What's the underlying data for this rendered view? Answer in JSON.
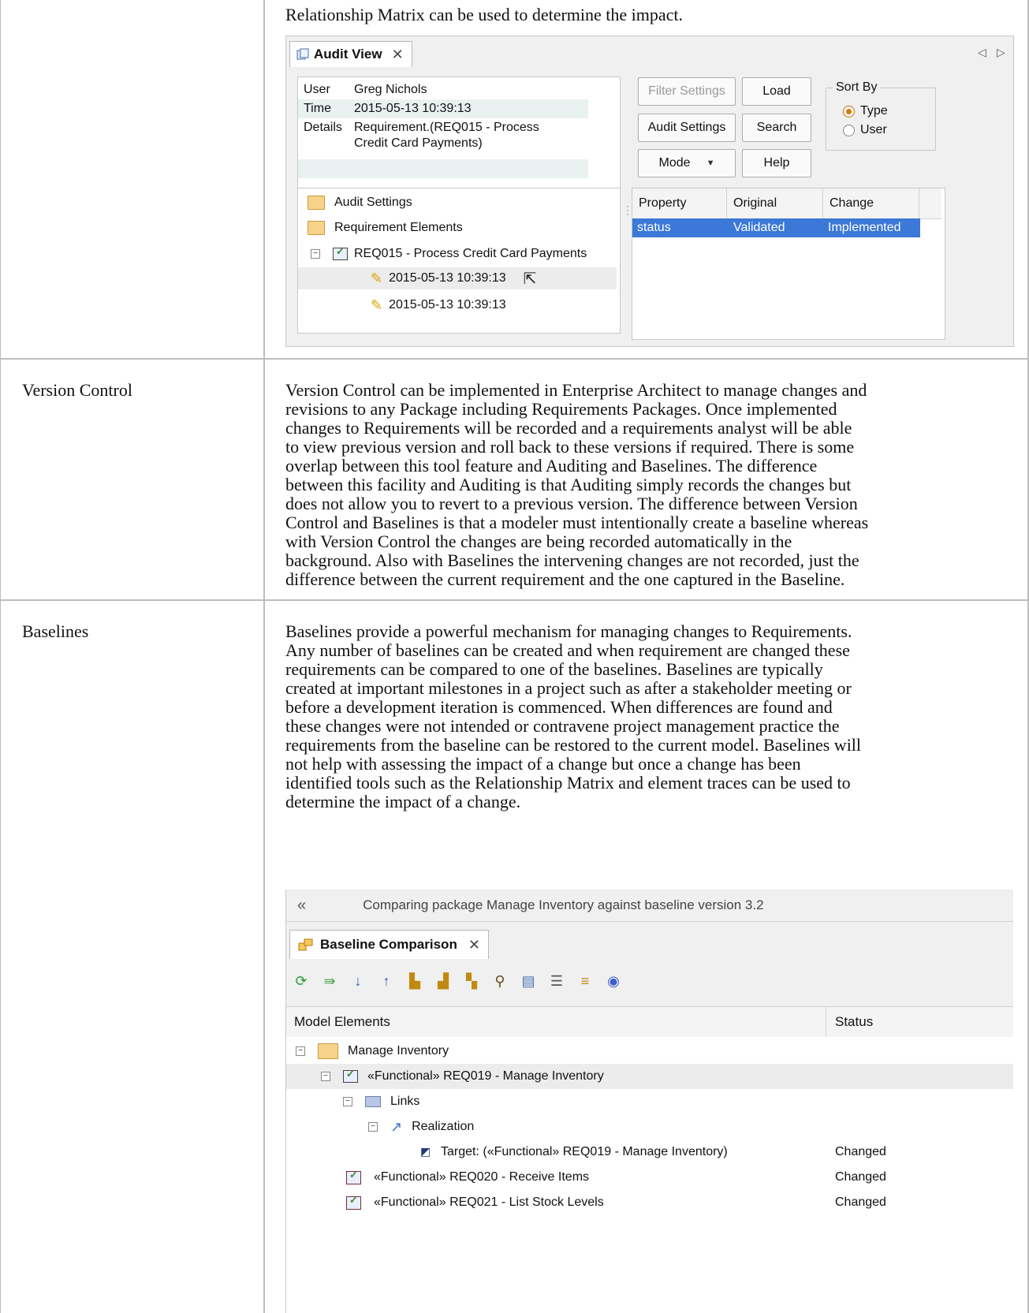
{
  "row_top": {
    "text": "Relationship Matrix can be used to determine the impact."
  },
  "audit_view": {
    "tab_label": "Audit View",
    "info": [
      {
        "key": "User",
        "value": "Greg Nichols"
      },
      {
        "key": "Time",
        "value": "2015-05-13 10:39:13"
      },
      {
        "key": "Details",
        "value": "Requirement.(REQ015 - Process"
      },
      {
        "key": "",
        "value": "Credit Card Payments)"
      }
    ],
    "buttons": {
      "filter_settings": "Filter Settings",
      "load": "Load",
      "audit_settings": "Audit Settings",
      "search": "Search",
      "mode": "Mode",
      "help": "Help"
    },
    "sort_by": {
      "label": "Sort By",
      "options": [
        "Type",
        "User"
      ],
      "selected": "Type"
    },
    "tree": {
      "audit_settings": "Audit Settings",
      "requirement_elements": "Requirement Elements",
      "requirement": "REQ015 - Process Credit Card Payments",
      "entries": [
        "2015-05-13 10:39:13",
        "2015-05-13 10:39:13"
      ]
    },
    "grid": {
      "columns": [
        "Property",
        "Original",
        "Change"
      ],
      "rows": [
        {
          "property": "status",
          "original": "Validated",
          "change": "Implemented"
        }
      ]
    }
  },
  "row_version_control": {
    "label": "Version Control",
    "lines": [
      "Version Control can be implemented in Enterprise Architect to manage changes and",
      "revisions to any Package including Requirements Packages. Once implemented",
      "changes to Requirements will be recorded and a requirements analyst will be able",
      "to view previous version and roll back to these versions if required. There is some",
      "overlap between this tool feature and Auditing and Baselines. The difference",
      "between this facility and Auditing is that Auditing simply records the changes but",
      "does not allow you to revert to a previous version. The difference between Version",
      "Control and Baselines is that a modeler must intentionally create a baseline whereas",
      "with Version Control the changes are being recorded automatically in the",
      "background. Also with Baselines the intervening changes are not recorded, just the",
      "difference between the current requirement and the one captured in the Baseline."
    ]
  },
  "row_baselines": {
    "label": "Baselines",
    "lines": [
      "Baselines provide a powerful mechanism for managing changes to Requirements.",
      "Any number of baselines can be created and when requirement are changed these",
      "requirements can be compared to one of the baselines. Baselines are typically",
      "created at important milestones in a project such as after a stakeholder meeting or",
      "before a development iteration is commenced. When differences are found and",
      "these changes were not intended or contravene project management practice the",
      "requirements from the baseline can be restored to the current model. Baselines will",
      "not help with assessing the impact of a change but once a change has been",
      "identified tools such as the Relationship Matrix and element traces can be used to",
      "determine the impact of a change."
    ]
  },
  "baseline_comparison": {
    "title_bar": "Comparing package Manage Inventory against baseline version 3.2",
    "tab_label": "Baseline Comparison",
    "columns": [
      "Model Elements",
      "Status"
    ],
    "rows": [
      {
        "label": "Manage Inventory",
        "status": ""
      },
      {
        "label": "«Functional» REQ019 - Manage Inventory",
        "status": ""
      },
      {
        "label": "Links",
        "status": ""
      },
      {
        "label": "Realization",
        "status": ""
      },
      {
        "label": "Target: («Functional» REQ019 - Manage Inventory)",
        "status": "Changed"
      },
      {
        "label": "«Functional» REQ020 - Receive Items",
        "status": "Changed"
      },
      {
        "label": "«Functional» REQ021 - List Stock Levels",
        "status": "Changed"
      }
    ]
  },
  "colors": {
    "selection": "#3b78d8",
    "border": "#bdbdbd",
    "panel": "#f0f0f0"
  }
}
